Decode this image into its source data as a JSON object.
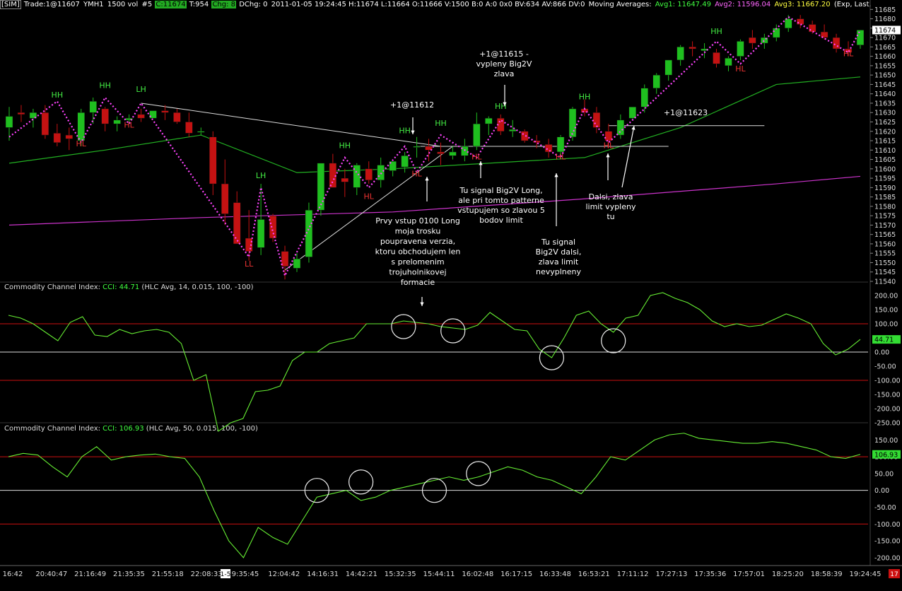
{
  "header": {
    "sim": "[SIM]",
    "trade": "Trade:1@11607",
    "symbol": "YMH1",
    "vol": "1500 vol",
    "bars": "#5",
    "close": "C:11674",
    "tick": "T:954",
    "chg": "Chg: 8",
    "dchg": "DChg: 0",
    "quote": "2011-01-05 19:24:45 H:11674 L:11664 O:11666 V:1500 B:0 A:0 0x0 BV:634 AV:866 DV:0",
    "ma_label": "Moving Averages:",
    "avg1": "Avg1: 11647.49",
    "avg2": "Avg2: 11596.04",
    "avg3": "Avg3: 11667.20",
    "tail": "(Exp, Last, 34,"
  },
  "colors": {
    "bull": "#1fbf1f",
    "bear": "#c41212",
    "ma_green": "#22b022",
    "ma_magenta": "#cc33cc",
    "zigzag": "#ff44ff",
    "cci": "#66ee33",
    "level_red": "#cc1111"
  },
  "price_axis": {
    "ticks": [
      "11685",
      "11680",
      "11675",
      "11670",
      "11665",
      "11660",
      "11655",
      "11650",
      "11645",
      "11640",
      "11635",
      "11630",
      "11625",
      "11620",
      "11615",
      "11610",
      "11605",
      "11600",
      "11595",
      "11590",
      "11585",
      "11580",
      "11575",
      "11570",
      "11565",
      "11560",
      "11555",
      "11550",
      "11545",
      "11540"
    ],
    "current": "11674"
  },
  "time_axis": [
    "16:42",
    "20:40:47",
    "21:16:49",
    "21:35:35",
    "21:55:18",
    "22:08:33",
    "9:35:45",
    "12:04:42",
    "14:16:31",
    "14:42:21",
    "15:32:35",
    "15:44:11",
    "16:02:48",
    "16:17:15",
    "16:33:48",
    "16:53:21",
    "17:11:12",
    "17:27:13",
    "17:35:36",
    "17:57:01",
    "18:25:20",
    "18:58:39",
    "19:24:45"
  ],
  "time_marker": "1-5",
  "corner_tag": "17",
  "chart_data": [
    {
      "type": "candlestick",
      "title": "YMH1 1500 vol",
      "ylim": [
        11540,
        11687
      ],
      "candles": [
        [
          11622,
          11633,
          11615,
          11628
        ],
        [
          11630,
          11634,
          11625,
          11629
        ],
        [
          11627,
          11632,
          11622,
          11630
        ],
        [
          11630,
          11634,
          11616,
          11618
        ],
        [
          11619,
          11624,
          11612,
          11614
        ],
        [
          11618,
          11622,
          11610,
          11616
        ],
        [
          11615,
          11632,
          11612,
          11630
        ],
        [
          11630,
          11638,
          11624,
          11636
        ],
        [
          11632,
          11633,
          11620,
          11624
        ],
        [
          11624,
          11628,
          11620,
          11626
        ],
        [
          11626,
          11629,
          11624,
          11627
        ],
        [
          11629,
          11632,
          11625,
          11627
        ],
        [
          11627,
          11631,
          11628,
          11631
        ],
        [
          11631,
          11634,
          11626,
          11630
        ],
        [
          11630,
          11632,
          11624,
          11625
        ],
        [
          11625,
          11630,
          11617,
          11619
        ],
        [
          11620,
          11622,
          11618,
          11620
        ],
        [
          11617,
          11620,
          11586,
          11592
        ],
        [
          11592,
          11605,
          11570,
          11576
        ],
        [
          11582,
          11588,
          11566,
          11560
        ],
        [
          11563,
          11578,
          11551,
          11556
        ],
        [
          11558,
          11592,
          11554,
          11573
        ],
        [
          11575,
          11576,
          11561,
          11563
        ],
        [
          11556,
          11559,
          11541,
          11548
        ],
        [
          11547,
          11555,
          11545,
          11552
        ],
        [
          11553,
          11582,
          11550,
          11578
        ],
        [
          11578,
          11603,
          11575,
          11603
        ],
        [
          11603,
          11608,
          11590,
          11590
        ],
        [
          11595,
          11600,
          11585,
          11593
        ],
        [
          11590,
          11603,
          11586,
          11602
        ],
        [
          11600,
          11604,
          11592,
          11594
        ],
        [
          11594,
          11606,
          11590,
          11602
        ],
        [
          11599,
          11604,
          11596,
          11604
        ],
        [
          11601,
          11609,
          11598,
          11607
        ],
        [
          11612,
          11617,
          11606,
          11612
        ],
        [
          11612,
          11616,
          11604,
          11610
        ],
        [
          11609,
          11614,
          11602,
          11608
        ],
        [
          11607,
          11612,
          11605,
          11609
        ],
        [
          11607,
          11616,
          11604,
          11612
        ],
        [
          11612,
          11630,
          11610,
          11624
        ],
        [
          11624,
          11628,
          11618,
          11627
        ],
        [
          11627,
          11629,
          11618,
          11620
        ],
        [
          11620,
          11626,
          11617,
          11621
        ],
        [
          11620,
          11621,
          11614,
          11615
        ],
        [
          11615,
          11618,
          11611,
          11614
        ],
        [
          11613,
          11616,
          11606,
          11609
        ],
        [
          11609,
          11618,
          11605,
          11617
        ],
        [
          11617,
          11633,
          11615,
          11632
        ],
        [
          11632,
          11637,
          11628,
          11630
        ],
        [
          11630,
          11633,
          11619,
          11622
        ],
        [
          11620,
          11624,
          11611,
          11615
        ],
        [
          11618,
          11629,
          11616,
          11626
        ],
        [
          11627,
          11633,
          11626,
          11633
        ],
        [
          11633,
          11645,
          11630,
          11643
        ],
        [
          11643,
          11651,
          11640,
          11650
        ],
        [
          11650,
          11658,
          11647,
          11658
        ],
        [
          11658,
          11666,
          11655,
          11665
        ],
        [
          11665,
          11668,
          11660,
          11664
        ],
        [
          11663,
          11667,
          11659,
          11664
        ],
        [
          11662,
          11664,
          11654,
          11656
        ],
        [
          11655,
          11660,
          11652,
          11659
        ],
        [
          11660,
          11669,
          11658,
          11668
        ],
        [
          11670,
          11674,
          11664,
          11667
        ],
        [
          11667,
          11672,
          11664,
          11670
        ],
        [
          11670,
          11677,
          11668,
          11675
        ],
        [
          11675,
          11682,
          11673,
          11680
        ],
        [
          11680,
          11682,
          11675,
          11677
        ],
        [
          11677,
          11679,
          11672,
          11673
        ],
        [
          11673,
          11677,
          11669,
          11670
        ],
        [
          11670,
          11672,
          11662,
          11664
        ],
        [
          11664,
          11668,
          11660,
          11662
        ],
        [
          11666,
          11674,
          11664,
          11674
        ]
      ],
      "series": [
        {
          "name": "Avg1",
          "x": [
            0,
            8,
            16,
            24,
            32,
            40,
            48,
            56,
            64,
            71
          ],
          "values": [
            11603,
            11610,
            11618,
            11598,
            11600,
            11603,
            11606,
            11622,
            11645,
            11649
          ]
        },
        {
          "name": "Avg2",
          "x": [
            0,
            16,
            32,
            48,
            64,
            71
          ],
          "values": [
            11570,
            11574,
            11577,
            11584,
            11592,
            11596
          ]
        }
      ],
      "annotations": [
        {
          "text": "HH",
          "x": 4,
          "y": 11638,
          "color": "green"
        },
        {
          "text": "HL",
          "x": 6,
          "y": 11612,
          "color": "red"
        },
        {
          "text": "HH",
          "x": 8,
          "y": 11643,
          "color": "green"
        },
        {
          "text": "HL",
          "x": 10,
          "y": 11622,
          "color": "red"
        },
        {
          "text": "LH",
          "x": 11,
          "y": 11641,
          "color": "green"
        },
        {
          "text": "LL",
          "x": 20,
          "y": 11548,
          "color": "red"
        },
        {
          "text": "LH",
          "x": 21,
          "y": 11595,
          "color": "green"
        },
        {
          "text": "HH",
          "x": 28,
          "y": 11611,
          "color": "green"
        },
        {
          "text": "HL",
          "x": 30,
          "y": 11584,
          "color": "red"
        },
        {
          "text": "HH",
          "x": 33,
          "y": 11619,
          "color": "green"
        },
        {
          "text": "HL",
          "x": 34,
          "y": 11596,
          "color": "red"
        },
        {
          "text": "HH",
          "x": 36,
          "y": 11623,
          "color": "green"
        },
        {
          "text": "HL",
          "x": 39,
          "y": 11605,
          "color": "red"
        },
        {
          "text": "HH",
          "x": 41,
          "y": 11632,
          "color": "green"
        },
        {
          "text": "HL",
          "x": 46,
          "y": 11605,
          "color": "red"
        },
        {
          "text": "HH",
          "x": 48,
          "y": 11637,
          "color": "green"
        },
        {
          "text": "HL",
          "x": 50,
          "y": 11611,
          "color": "red"
        },
        {
          "text": "HH",
          "x": 59,
          "y": 11672,
          "color": "green"
        },
        {
          "text": "HL",
          "x": 61,
          "y": 11652,
          "color": "red"
        },
        {
          "text": "HL",
          "x": 70,
          "y": 11660,
          "color": "red"
        }
      ]
    },
    {
      "type": "line",
      "title": "Commodity Channel Index: CCI: 44.71 (HLC Avg, 14, 0.015, 100, -100)",
      "ylim": [
        -250,
        225
      ],
      "levels": [
        100,
        0,
        -100
      ],
      "ticks": [
        "200.00",
        "150.00",
        "100.00",
        "50.00",
        "0.00",
        "-50.00",
        "-100.00",
        "-150.00",
        "-200.00",
        "-250.00"
      ],
      "current": "44.71",
      "values": [
        130,
        120,
        100,
        70,
        40,
        105,
        125,
        60,
        55,
        80,
        65,
        75,
        80,
        70,
        30,
        -100,
        -80,
        -280,
        -250,
        -235,
        -140,
        -135,
        -120,
        -30,
        0,
        0,
        30,
        40,
        50,
        100,
        100,
        100,
        110,
        105,
        100,
        90,
        85,
        80,
        95,
        140,
        110,
        80,
        75,
        10,
        -20,
        50,
        130,
        145,
        100,
        70,
        120,
        130,
        200,
        210,
        190,
        175,
        150,
        110,
        90,
        100,
        90,
        95,
        115,
        135,
        120,
        100,
        30,
        -10,
        10,
        44.71
      ],
      "circles": [
        {
          "x": 32,
          "y": 90
        },
        {
          "x": 36,
          "y": 75
        },
        {
          "x": 44,
          "y": -20
        },
        {
          "x": 49,
          "y": 40
        }
      ]
    },
    {
      "type": "line",
      "title": "Commodity Channel Index: CCI: 106.93 (HLC Avg, 50, 0.015, 100, -100)",
      "ylim": [
        -215,
        180
      ],
      "levels": [
        100,
        0,
        -100
      ],
      "ticks": [
        "150.00",
        "100.00",
        "50.00",
        "0.00",
        "-50.00",
        "-100.00",
        "-150.00",
        "-200.00"
      ],
      "current": "106.93",
      "values": [
        100,
        110,
        105,
        70,
        40,
        100,
        130,
        90,
        100,
        105,
        108,
        100,
        95,
        40,
        -60,
        -150,
        -200,
        -110,
        -140,
        -160,
        -90,
        -20,
        -10,
        0,
        -30,
        -20,
        0,
        10,
        20,
        30,
        40,
        30,
        40,
        55,
        70,
        60,
        40,
        30,
        10,
        -10,
        40,
        100,
        90,
        120,
        150,
        165,
        170,
        155,
        150,
        145,
        140,
        140,
        145,
        140,
        130,
        120,
        100,
        95,
        106.93
      ],
      "circles": [
        {
          "x": 21,
          "y": 0
        },
        {
          "x": 24,
          "y": 25
        },
        {
          "x": 29,
          "y": 0
        },
        {
          "x": 32,
          "y": 50
        }
      ]
    }
  ],
  "price_annotations": [
    {
      "id": "a1",
      "lines": [
        "+1@11612"
      ]
    },
    {
      "id": "a2",
      "lines": [
        "+1@11615 -",
        "vypleny Big2V",
        "zlava"
      ]
    },
    {
      "id": "a3",
      "lines": [
        "+1@11623"
      ]
    },
    {
      "id": "a4",
      "lines": [
        "Prvy vstup 0100 Long",
        "moja trosku",
        "poupravena verzia,",
        "ktoru obchodujem len",
        "s prelomenim",
        "trojuholnikovej",
        "formacie"
      ]
    },
    {
      "id": "a5",
      "lines": [
        "Tu signal Big2V Long,",
        "ale pri tomto patterne",
        "vstupujem so zlavou 5",
        "bodov limit"
      ]
    },
    {
      "id": "a6",
      "lines": [
        "Tu signal",
        "Big2V dalsi,",
        "zlava limit",
        "nevyplneny"
      ]
    },
    {
      "id": "a7",
      "lines": [
        "Dalsi, zlava",
        "limit vypleny",
        "tu"
      ]
    }
  ]
}
